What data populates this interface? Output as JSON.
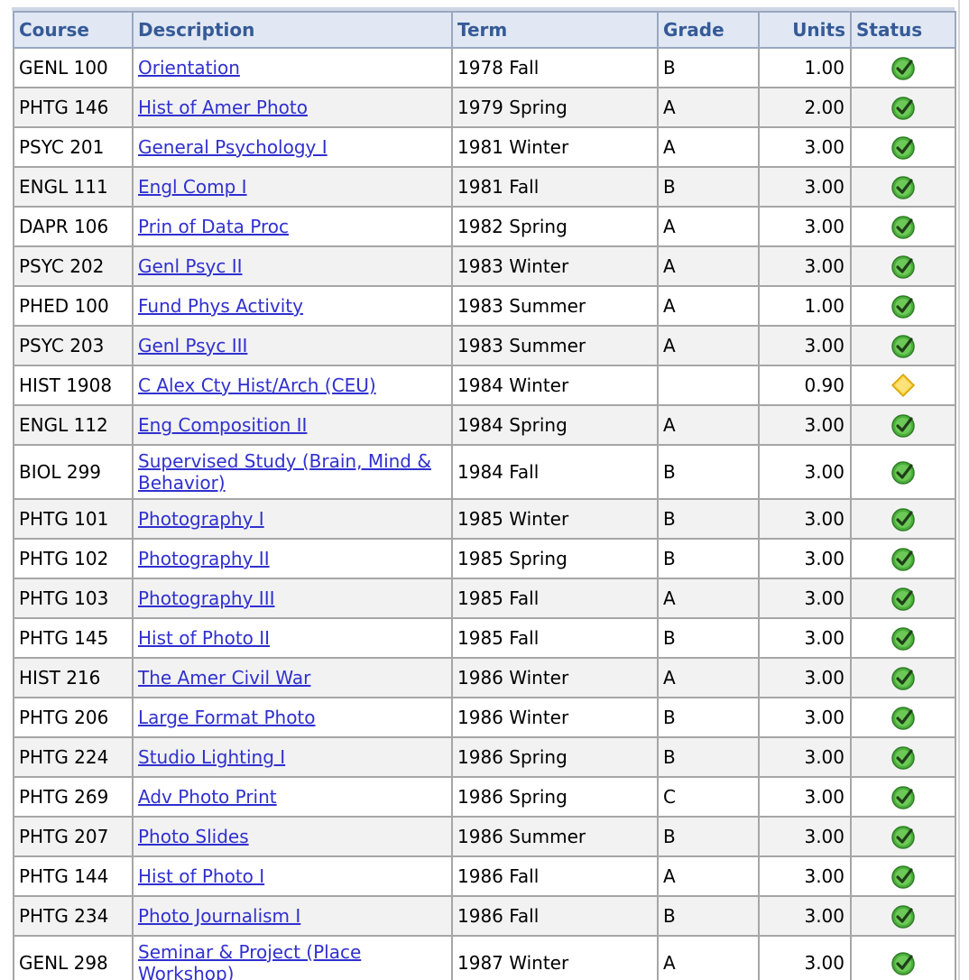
{
  "columns": {
    "course": "Course",
    "description": "Description",
    "term": "Term",
    "grade": "Grade",
    "units": "Units",
    "status": "Status"
  },
  "colors": {
    "link": "#3030d0",
    "header_text": "#355a97",
    "header_bg": "#e1e8f4",
    "check": "#4caf3c",
    "in_progress": "#f5c518"
  },
  "rows": [
    {
      "course": "GENL 100",
      "description": "Orientation",
      "term": "1978 Fall",
      "grade": "B",
      "units": "1.00",
      "status": "check-icon"
    },
    {
      "course": "PHTG 146",
      "description": "Hist of Amer Photo",
      "term": "1979 Spring",
      "grade": "A",
      "units": "2.00",
      "status": "check-icon"
    },
    {
      "course": "PSYC 201",
      "description": "General Psychology I",
      "term": "1981 Winter",
      "grade": "A",
      "units": "3.00",
      "status": "check-icon"
    },
    {
      "course": "ENGL 111",
      "description": "Engl Comp I",
      "term": "1981 Fall",
      "grade": "B",
      "units": "3.00",
      "status": "check-icon"
    },
    {
      "course": "DAPR 106",
      "description": "Prin of Data Proc",
      "term": "1982 Spring",
      "grade": "A",
      "units": "3.00",
      "status": "check-icon"
    },
    {
      "course": "PSYC 202",
      "description": "Genl Psyc II",
      "term": "1983 Winter",
      "grade": "A",
      "units": "3.00",
      "status": "check-icon"
    },
    {
      "course": "PHED 100",
      "description": "Fund Phys Activity",
      "term": "1983 Summer",
      "grade": "A",
      "units": "1.00",
      "status": "check-icon"
    },
    {
      "course": "PSYC 203",
      "description": "Genl Psyc III",
      "term": "1983 Summer",
      "grade": "A",
      "units": "3.00",
      "status": "check-icon"
    },
    {
      "course": "HIST 1908",
      "description": "C Alex Cty Hist/Arch (CEU)",
      "term": "1984 Winter",
      "grade": "",
      "units": "0.90",
      "status": "diamond-icon"
    },
    {
      "course": "ENGL 112",
      "description": "Eng Composition II",
      "term": "1984 Spring",
      "grade": "A",
      "units": "3.00",
      "status": "check-icon"
    },
    {
      "course": "BIOL 299",
      "description": "Supervised Study (Brain, Mind & Behavior)",
      "term": "1984 Fall",
      "grade": "B",
      "units": "3.00",
      "status": "check-icon"
    },
    {
      "course": "PHTG 101",
      "description": "Photography I",
      "term": "1985 Winter",
      "grade": "B",
      "units": "3.00",
      "status": "check-icon"
    },
    {
      "course": "PHTG 102",
      "description": "Photography II",
      "term": "1985 Spring",
      "grade": "B",
      "units": "3.00",
      "status": "check-icon"
    },
    {
      "course": "PHTG 103",
      "description": "Photography III",
      "term": "1985 Fall",
      "grade": "A",
      "units": "3.00",
      "status": "check-icon"
    },
    {
      "course": "PHTG 145",
      "description": "Hist of Photo II",
      "term": "1985 Fall",
      "grade": "B",
      "units": "3.00",
      "status": "check-icon"
    },
    {
      "course": "HIST 216",
      "description": "The Amer Civil War",
      "term": "1986 Winter",
      "grade": "A",
      "units": "3.00",
      "status": "check-icon"
    },
    {
      "course": "PHTG 206",
      "description": "Large Format Photo",
      "term": "1986 Winter",
      "grade": "B",
      "units": "3.00",
      "status": "check-icon"
    },
    {
      "course": "PHTG 224",
      "description": "Studio Lighting I",
      "term": "1986 Spring",
      "grade": "B",
      "units": "3.00",
      "status": "check-icon"
    },
    {
      "course": "PHTG 269",
      "description": "Adv Photo Print",
      "term": "1986 Spring",
      "grade": "C",
      "units": "3.00",
      "status": "check-icon"
    },
    {
      "course": "PHTG 207",
      "description": "Photo Slides",
      "term": "1986 Summer",
      "grade": "B",
      "units": "3.00",
      "status": "check-icon"
    },
    {
      "course": "PHTG 144",
      "description": "Hist of Photo I",
      "term": "1986 Fall",
      "grade": "A",
      "units": "3.00",
      "status": "check-icon"
    },
    {
      "course": "PHTG 234",
      "description": "Photo Journalism I",
      "term": "1986 Fall",
      "grade": "B",
      "units": "3.00",
      "status": "check-icon"
    },
    {
      "course": "GENL 298",
      "description": "Seminar & Project (Place Workshop)",
      "term": "1987 Winter",
      "grade": "A",
      "units": "3.00",
      "status": "check-icon"
    }
  ]
}
